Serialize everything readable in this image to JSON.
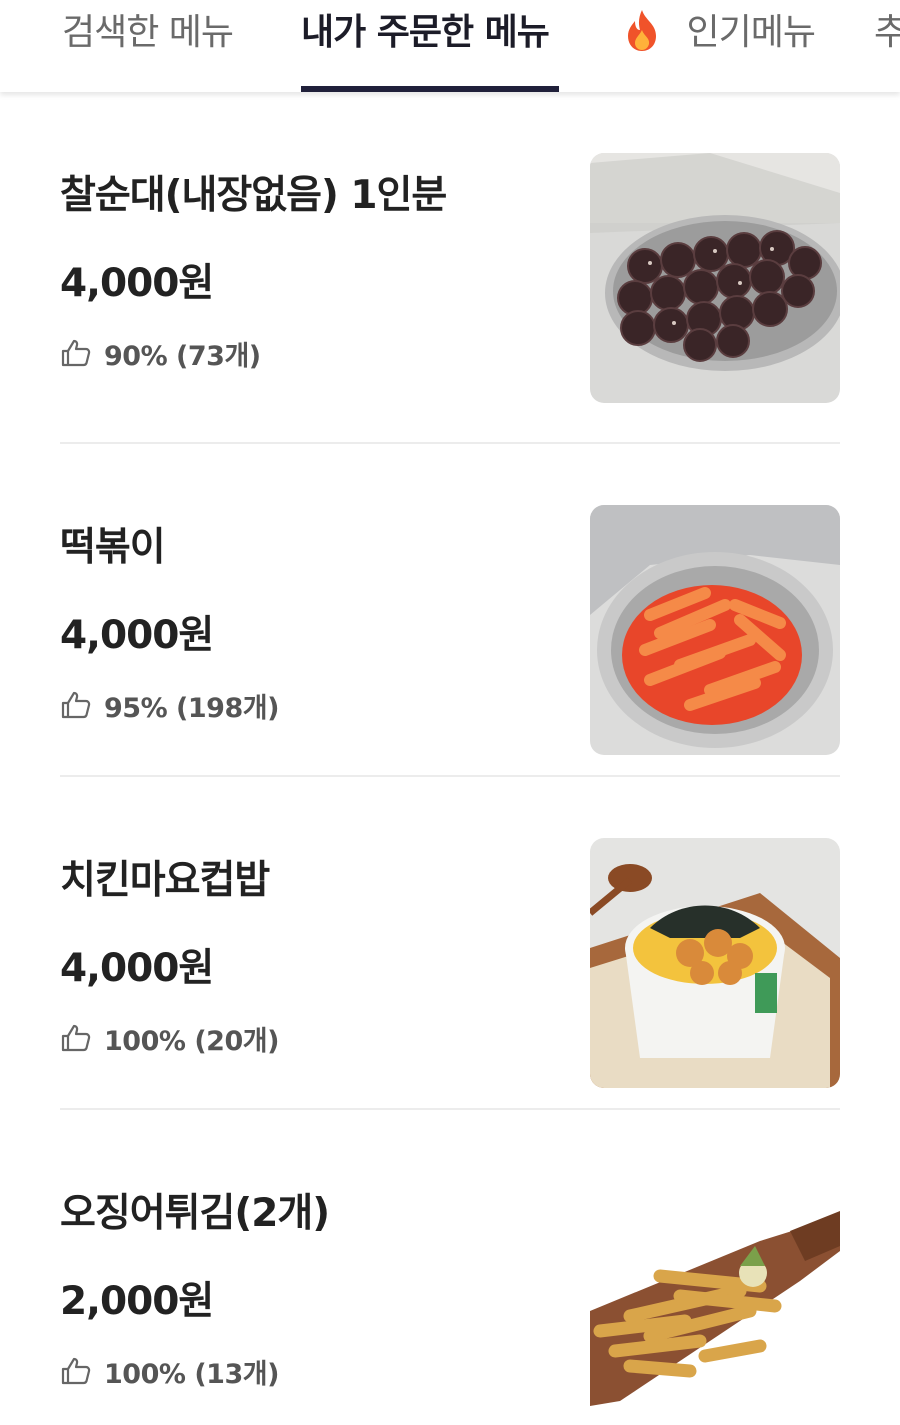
{
  "tabs": {
    "searched": "검색한 메뉴",
    "ordered": "내가 주문한 메뉴",
    "popular": "인기메뉴",
    "more": "추"
  },
  "active_tab": "ordered",
  "items": [
    {
      "name": "찰순대(내장없음) 1인분",
      "price": "4,000원",
      "rating": "90% (73개)",
      "image": "soondae-photo"
    },
    {
      "name": "떡볶이",
      "price": "4,000원",
      "rating": "95% (198개)",
      "image": "tteokbokki-photo"
    },
    {
      "name": "치킨마요컵밥",
      "price": "4,000원",
      "rating": "100% (20개)",
      "image": "chicken-mayo-cupbap-photo"
    },
    {
      "name": "오징어튀김(2개)",
      "price": "2,000원",
      "rating": "100% (13개)",
      "image": "fried-squid-photo"
    }
  ],
  "icons": {
    "rating": "thumbs-up-icon",
    "popular_tab": "fire-icon"
  },
  "colors": {
    "active_tab_text": "#1c1c28",
    "active_tab_underline": "#20203a",
    "inactive_tab_text": "#6a6a6a"
  }
}
